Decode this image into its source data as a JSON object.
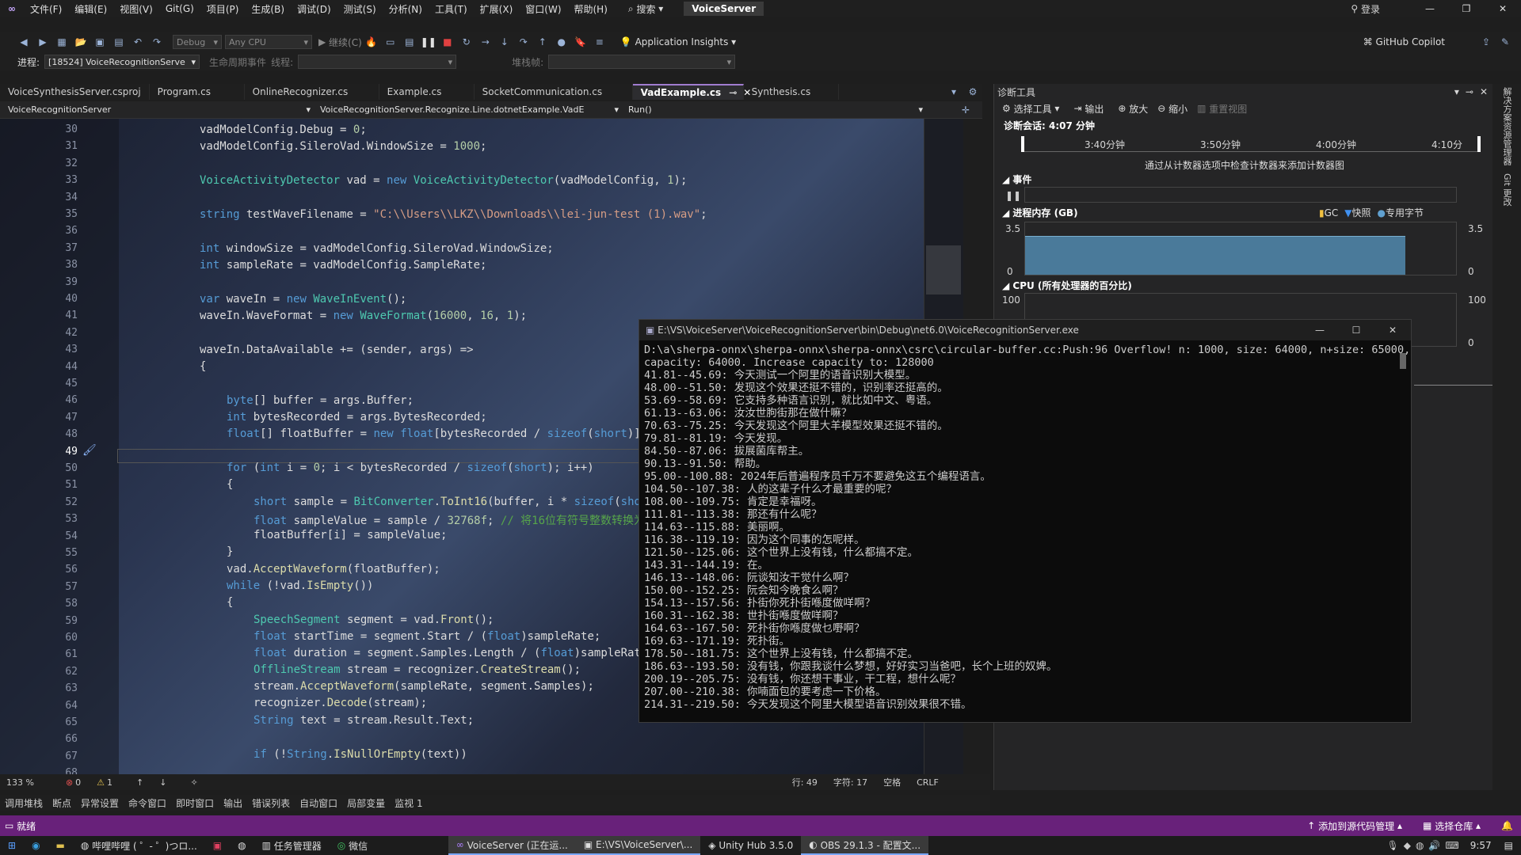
{
  "titlebar": {
    "menu": [
      "文件(F)",
      "编辑(E)",
      "视图(V)",
      "Git(G)",
      "项目(P)",
      "生成(B)",
      "调试(D)",
      "测试(S)",
      "分析(N)",
      "工具(T)",
      "扩展(X)",
      "窗口(W)",
      "帮助(H)"
    ],
    "search": "搜索",
    "title": "VoiceServer",
    "login": "登录"
  },
  "toolbar": {
    "config": "Debug",
    "platform": "Any CPU",
    "continue": "继续(C)",
    "app_insights": "Application Insights",
    "copilot": "GitHub Copilot"
  },
  "toolbar2": {
    "process_label": "进程:",
    "process_value": "[18524] VoiceRecognitionServe",
    "lifecycle": "生命周期事件",
    "thread": "线程:",
    "stackframe": "堆栈帧:"
  },
  "tabs": [
    "VoiceSynthesisServer.csproj",
    "Program.cs",
    "OnlineRecognizer.cs",
    "Example.cs",
    "SocketCommunication.cs",
    "VadExample.cs",
    "Synthesis.cs"
  ],
  "active_tab": "VadExample.cs",
  "navbar": {
    "project": "VoiceRecognitionServer",
    "class": "VoiceRecognitionServer.Recognize.Line.dotnetExample.VadE",
    "member": "Run()"
  },
  "line_numbers": [
    "30",
    "31",
    "32",
    "33",
    "34",
    "35",
    "36",
    "37",
    "38",
    "39",
    "40",
    "41",
    "42",
    "43",
    "44",
    "45",
    "46",
    "47",
    "48",
    "49",
    "50",
    "51",
    "52",
    "53",
    "54",
    "55",
    "56",
    "57",
    "58",
    "59",
    "60",
    "61",
    "62",
    "63",
    "64",
    "65",
    "66",
    "67",
    "68"
  ],
  "current_line": "49",
  "editor_status": {
    "zoom": "133 %",
    "errors": "0",
    "warnings": "1",
    "line": "行: 49",
    "char": "字符: 17",
    "space": "空格",
    "eol": "CRLF"
  },
  "bottom_tabs": [
    "调用堆栈",
    "断点",
    "异常设置",
    "命令窗口",
    "即时窗口",
    "输出",
    "错误列表",
    "自动窗口",
    "局部变量",
    "监视 1"
  ],
  "statusbar": {
    "ready": "就绪",
    "source_control": "添加到源代码管理",
    "repo": "选择仓库"
  },
  "diag": {
    "title": "诊断工具",
    "select_tool": "选择工具",
    "output": "输出",
    "zoom_in": "放大",
    "zoom_out": "缩小",
    "reset": "重置视图",
    "session": "诊断会话: 4:07 分钟",
    "times": [
      "3:40分钟",
      "3:50分钟",
      "4:00分钟",
      "4:10分"
    ],
    "hint": "通过从计数器选项中检查计数器来添加计数器图",
    "events": "事件",
    "memory": "进程内存 (GB)",
    "gc": "GC",
    "snapshot": "快照",
    "private": "专用字节",
    "mem_max": "3.5",
    "mem_min": "0",
    "cpu": "CPU (所有处理器的百分比)",
    "cpu_max": "100",
    "cpu_min": "0",
    "mem_fill": 0.75,
    "side": [
      "解决方案资源管理器",
      "Git 更改"
    ]
  },
  "console": {
    "title": "E:\\VS\\VoiceServer\\VoiceRecognitionServer\\bin\\Debug\\net6.0\\VoiceRecognitionServer.exe",
    "lines": [
      "D:\\a\\sherpa-onnx\\sherpa-onnx\\sherpa-onnx\\csrc\\circular-buffer.cc:Push:96 Overflow! n: 1000, size: 64000, n+size: 65000,",
      "capacity: 64000. Increase capacity to: 128000",
      "41.81--45.69: 今天测试一个阿里的语音识别大模型。",
      "48.00--51.50: 发现这个效果还挺不错的，识别率还挺高的。",
      "53.69--58.69: 它支持多种语言识别，就比如中文、粤语。",
      "61.13--63.06: 汝汝世朐街那在做什嘛？",
      "70.63--75.25: 今天发现这个阿里大羊模型效果还挺不错的。",
      "79.81--81.19: 今天发现。",
      "84.50--87.06: 拔展菌库帮主。",
      "90.13--91.50: 帮助。",
      "95.00--100.88: 2024年后普遍程序员千万不要避免这五个编程语言。",
      "104.50--107.38: 人的这辈子什么才最重要的呢？",
      "108.00--109.75: 肯定是幸福呀。",
      "111.81--113.38: 那还有什么呢？",
      "114.63--115.88: 美丽啊。",
      "116.38--119.19: 因为这个同事的怎呢样。",
      "121.50--125.06: 这个世界上没有钱，什么都搞不定。",
      "143.31--144.19: 在。",
      "146.13--148.06: 阮谈知汝干觉什么啊？",
      "150.00--152.25: 阮会知今晚食么啊？",
      "154.13--157.56: 扑街你死扑街喺度做咩啊？",
      "160.31--162.38: 世扑街喺度做咩啊？",
      "164.63--167.50: 死扑街你喺度做乜嘢啊？",
      "169.63--171.19: 死扑街。",
      "178.50--181.75: 这个世界上没有钱，什么都搞不定。",
      "186.63--193.50: 没有钱，你跟我谈什么梦想，好好实习当爸吧，长个上班的奴婢。",
      "200.19--205.75: 没有钱，你还想干事业，干工程，想什么呢？",
      "207.00--210.38: 你喃面包的要考虑一下价格。",
      "214.31--219.50: 今天发现这个阿里大模型语音识别效果很不错。"
    ]
  },
  "taskbar": {
    "items": [
      "哔哩哔哩 ( ゜- ゜)つロ...",
      "任务管理器",
      "微信",
      "VoiceServer (正在运...",
      "E:\\VS\\VoiceServer\\...",
      "Unity Hub 3.5.0",
      "OBS 29.1.3 - 配置文..."
    ],
    "clock": "9:57"
  },
  "colors": {
    "accent": "#68217a",
    "tab_active_border": "#a07cd0",
    "memory_fill": "#4a7a9a"
  }
}
